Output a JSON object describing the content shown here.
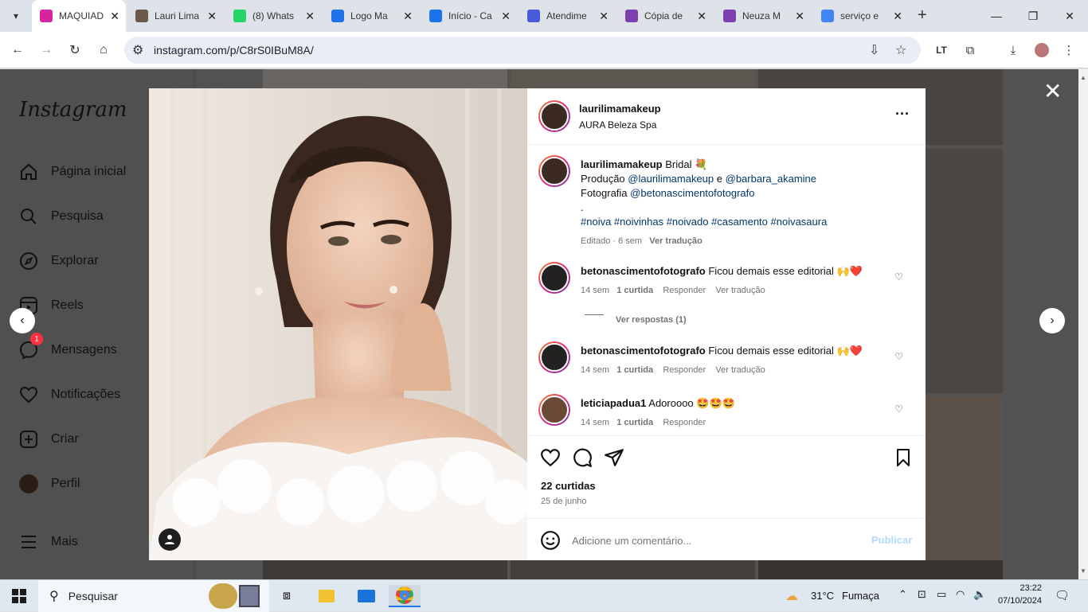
{
  "browser": {
    "tabs": [
      {
        "title": "MAQUIAD",
        "favicon_color": "#d6249f",
        "active": true
      },
      {
        "title": "Lauri Lima",
        "favicon_color": "#6b5a4a",
        "active": false
      },
      {
        "title": "(8) Whats",
        "favicon_color": "#25d366",
        "active": false
      },
      {
        "title": "Logo Ma",
        "favicon_color": "#1e73e8",
        "active": false
      },
      {
        "title": "Início - Ca",
        "favicon_color": "#1e73e8",
        "active": false
      },
      {
        "title": "Atendime",
        "favicon_color": "#4a5bd9",
        "active": false
      },
      {
        "title": "Cópia de",
        "favicon_color": "#7b3fb0",
        "active": false
      },
      {
        "title": "Neuza M",
        "favicon_color": "#7b3fb0",
        "active": false
      },
      {
        "title": "serviço e",
        "favicon_color": "#4285f4",
        "active": false
      }
    ],
    "url": "instagram.com/p/C8rS0IBuM8A/"
  },
  "sidebar": {
    "logo": "Instagram",
    "items": [
      {
        "label": "Página inicial",
        "icon": "home-icon"
      },
      {
        "label": "Pesquisa",
        "icon": "search-icon"
      },
      {
        "label": "Explorar",
        "icon": "compass-icon"
      },
      {
        "label": "Reels",
        "icon": "reels-icon"
      },
      {
        "label": "Mensagens",
        "icon": "messenger-icon",
        "badge": "1"
      },
      {
        "label": "Notificações",
        "icon": "heart-icon"
      },
      {
        "label": "Criar",
        "icon": "plus-square-icon"
      },
      {
        "label": "Perfil",
        "icon": "profile-avatar"
      }
    ],
    "more": "Mais"
  },
  "post": {
    "author": "laurilimamakeup",
    "location": "AURA Beleza Spa",
    "caption": {
      "line1": "Bridal 💐",
      "line2_prefix": "Produção",
      "line2_mention1": "@laurilimamakeup",
      "line2_and": "e",
      "line2_mention2": "@barbara_akamine",
      "line3_prefix": "Fotografia",
      "line3_mention": "@betonascimentofotografo",
      "line4": ".",
      "hashtags": "#noiva #noivinhas #noivado #casamento #noivasaura",
      "meta_time": "Editado · 6 sem",
      "meta_translate": "Ver tradução"
    },
    "comments": [
      {
        "user": "betonascimentofotografo",
        "text": "Ficou demais esse editorial 🙌❤️",
        "time": "14 sem",
        "likes": "1 curtida",
        "reply": "Responder",
        "translate": "Ver tradução"
      },
      {
        "user": "betonascimentofotografo",
        "text": "Ficou demais esse editorial 🙌❤️",
        "time": "14 sem",
        "likes": "1 curtida",
        "reply": "Responder",
        "translate": "Ver tradução"
      },
      {
        "user": "leticiapadua1",
        "text": "Adoroooo 🤩🤩🤩",
        "time": "14 sem",
        "likes": "1 curtida",
        "reply": "Responder"
      }
    ],
    "view_replies": "Ver respostas (1)",
    "likes": "22 curtidas",
    "date": "25 de junho",
    "add_comment_placeholder": "Adicione um comentário...",
    "publish": "Publicar"
  },
  "taskbar": {
    "search": "Pesquisar",
    "weather_temp": "31°C",
    "weather_desc": "Fumaça",
    "time": "23:22",
    "date": "07/10/2024"
  }
}
